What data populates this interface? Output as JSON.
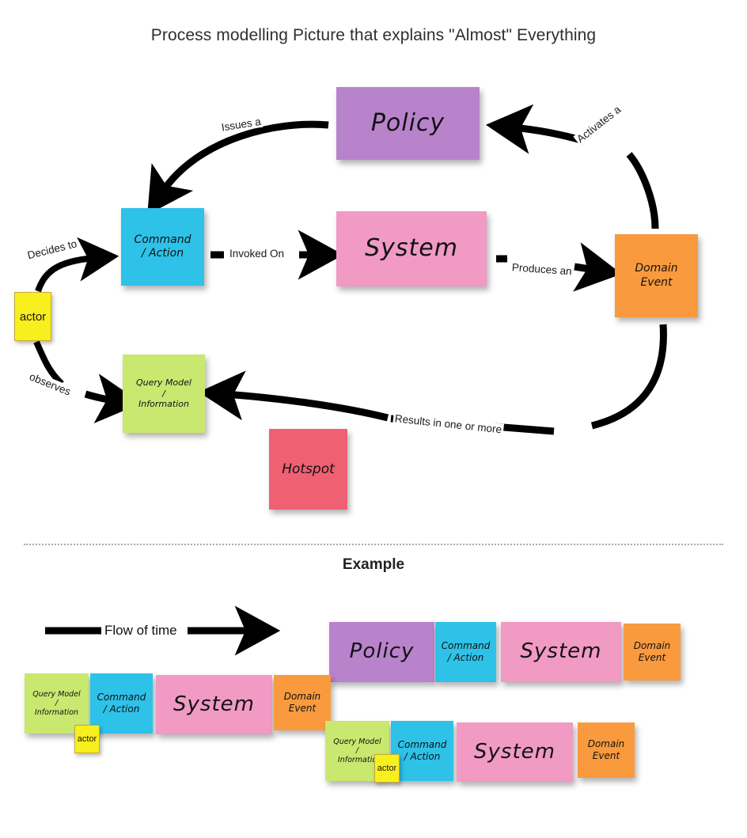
{
  "header": {
    "title": "Process modelling Picture that explains \"Almost\" Everything",
    "example_title": "Example"
  },
  "colors": {
    "policy": "#b983cc",
    "command": "#2ec2e8",
    "system": "#f09ac4",
    "domain_event": "#f99a3e",
    "query_model": "#c8e870",
    "hotspot": "#ef6073",
    "actor": "#f8ef1e",
    "arrow": "#000000",
    "text": "#1a1a1a"
  },
  "diagram": {
    "notes": [
      {
        "id": "policy",
        "label": "Policy"
      },
      {
        "id": "command",
        "label": "Command\n/ Action"
      },
      {
        "id": "system",
        "label": "System"
      },
      {
        "id": "domain-event",
        "label": "Domain\nEvent"
      },
      {
        "id": "query-model",
        "label": "Query Model\n/\nInformation"
      },
      {
        "id": "hotspot",
        "label": "Hotspot"
      },
      {
        "id": "actor",
        "label": "actor"
      }
    ],
    "arrow_labels": {
      "issues_a": "Issues a",
      "decides_to": "Decides to",
      "invoked_on": "Invoked On",
      "produces_an": "Produces an",
      "activates_a": "Activates a",
      "observes": "observes",
      "results_in_one_or_more": "Results in one or more"
    }
  },
  "example": {
    "flow_label": "Flow of time",
    "rows": [
      {
        "id": "row-1",
        "notes": [
          {
            "id": "query-model",
            "label": "Query Model\n/\nInformation"
          },
          {
            "id": "command",
            "label": "Command\n/ Action"
          },
          {
            "id": "actor",
            "label": "actor"
          },
          {
            "id": "system",
            "label": "System"
          },
          {
            "id": "domain-event",
            "label": "Domain\nEvent"
          }
        ]
      },
      {
        "id": "row-2",
        "notes": [
          {
            "id": "policy",
            "label": "Policy"
          },
          {
            "id": "command",
            "label": "Command\n/ Action"
          },
          {
            "id": "system",
            "label": "System"
          },
          {
            "id": "domain-event",
            "label": "Domain\nEvent"
          }
        ]
      },
      {
        "id": "row-3",
        "notes": [
          {
            "id": "query-model",
            "label": "Query Model\n/\nInformatio"
          },
          {
            "id": "command",
            "label": "Command\n/ Action"
          },
          {
            "id": "actor",
            "label": "actor"
          },
          {
            "id": "system",
            "label": "System"
          },
          {
            "id": "domain-event",
            "label": "Domain\nEvent"
          }
        ]
      }
    ]
  }
}
